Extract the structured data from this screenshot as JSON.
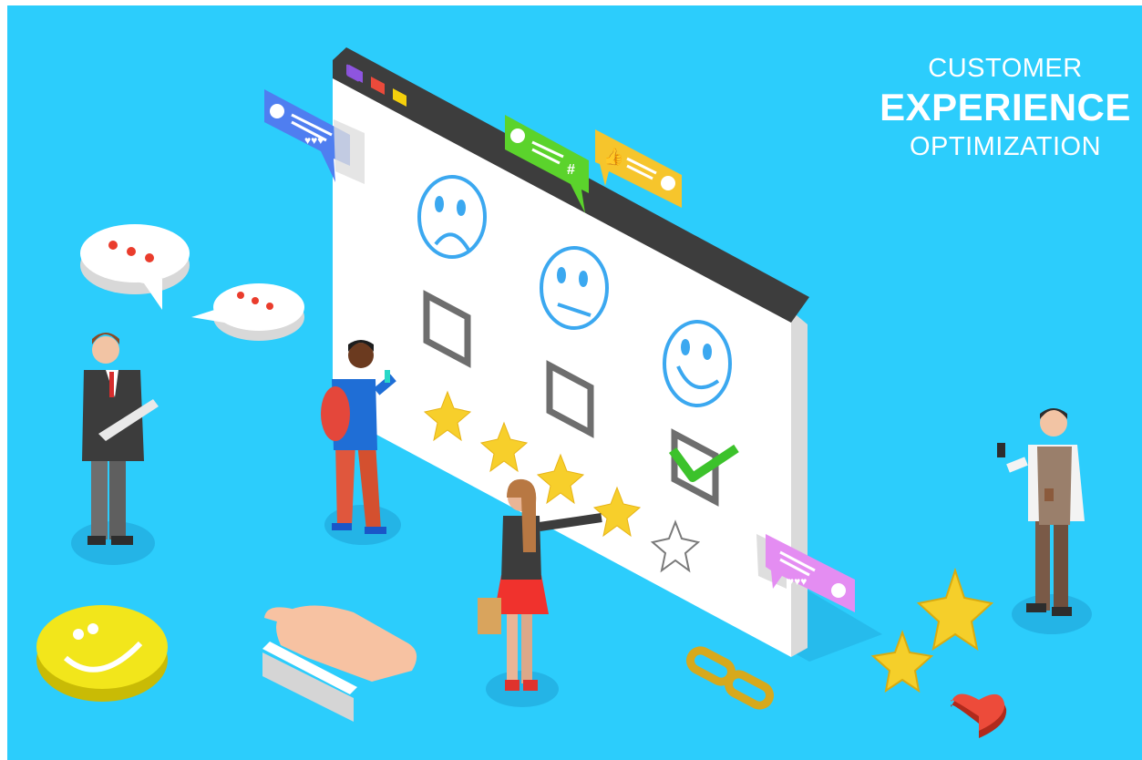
{
  "headline": {
    "line1": "CUSTOMER",
    "line2": "EXPERIENCE",
    "line3": "OPTIMIZATION"
  },
  "survey_board": {
    "faces": [
      "sad-face-icon",
      "neutral-face-icon",
      "happy-face-icon"
    ],
    "checkboxes_checked": [
      false,
      false,
      true
    ],
    "star_rating": 4,
    "star_max": 5
  },
  "icons": [
    "speech-bubble-icon",
    "like-bubble-icon",
    "hashtag-bubble-icon",
    "heart-bubble-icon",
    "thumbs-up-icon",
    "smiley-coin-icon",
    "chain-link-icon",
    "heart-icon",
    "star-icon"
  ],
  "colors": {
    "background": "#2ccdfc",
    "board_frame": "#3d3d3d",
    "face_outline": "#3ba8f0",
    "star": "#f7cf2b",
    "check": "#3cc22b",
    "title_text": "#ffffff"
  }
}
